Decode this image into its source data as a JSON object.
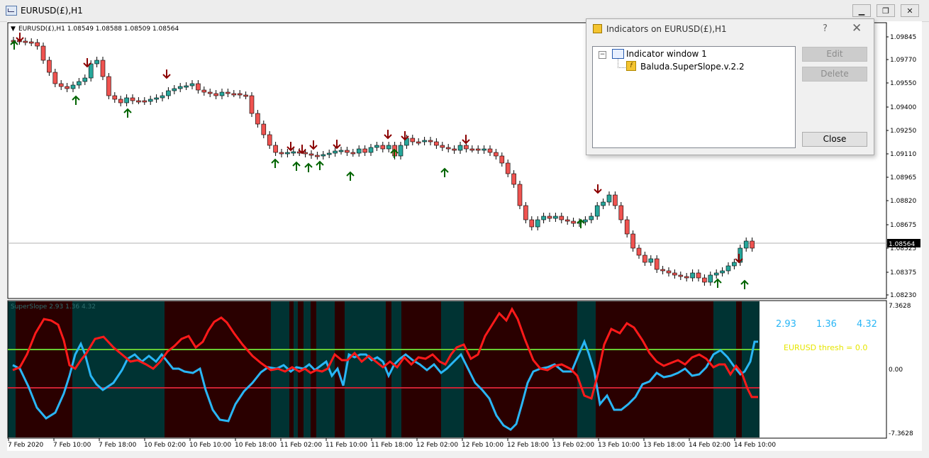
{
  "window": {
    "title": "EURUSD(£),H1",
    "minimize": "▁",
    "maximize": "❐",
    "close": "✕"
  },
  "chart": {
    "header": "EURUSD(£),H1  1.08549 1.08588 1.08509 1.08564",
    "current_price": "1.08564",
    "price_ticks": [
      "1.09845",
      "1.09770",
      "1.09550",
      "1.09400",
      "1.09250",
      "1.09110",
      "1.08965",
      "1.08820",
      "1.08675",
      "1.08525",
      "1.08375",
      "1.08230"
    ],
    "time_labels": [
      "7 Feb 2020",
      "7 Feb 10:00",
      "7 Feb 18:00",
      "10 Feb 02:00",
      "10 Feb 10:00",
      "10 Feb 18:00",
      "11 Feb 02:00",
      "11 Feb 10:00",
      "11 Feb 18:00",
      "12 Feb 02:00",
      "12 Feb 10:00",
      "12 Feb 18:00",
      "13 Feb 02:00",
      "13 Feb 10:00",
      "13 Feb 18:00",
      "14 Feb 02:00",
      "14 Feb 10:00"
    ]
  },
  "indicator": {
    "header": "SuperSlope  2.93  1.36  4.32",
    "value_1": "2.93",
    "value_2": "1.36",
    "value_3": "4.32",
    "thresh_text": "EURUSD thresh = 0.0",
    "axis_top": "7.3628",
    "axis_zero": "0.00",
    "axis_bottom": "-7.3628"
  },
  "colors": {
    "bull_candle": "#26a69a",
    "bear_candle": "#ef5350",
    "up_arrow": "#006400",
    "down_arrow": "#8b0000",
    "blue_line": "#29b6f6",
    "red_line": "#ff1a1a",
    "band_bull": "#003333",
    "band_bear": "#2a0000",
    "upper_level": "#66cc33",
    "lower_level": "#cc2233",
    "value_text": "#29b6f6",
    "thresh_text": "#e6e600"
  },
  "dialog": {
    "title": "Indicators on EURUSD(£),H1",
    "help": "?",
    "close_x": "✕",
    "tree_window": "Indicator window 1",
    "tree_expander": "−",
    "tree_indicator": "Baluda.SuperSlope.v.2.2",
    "edit_button": "Edit",
    "delete_button": "Delete",
    "close_button": "Close"
  }
}
